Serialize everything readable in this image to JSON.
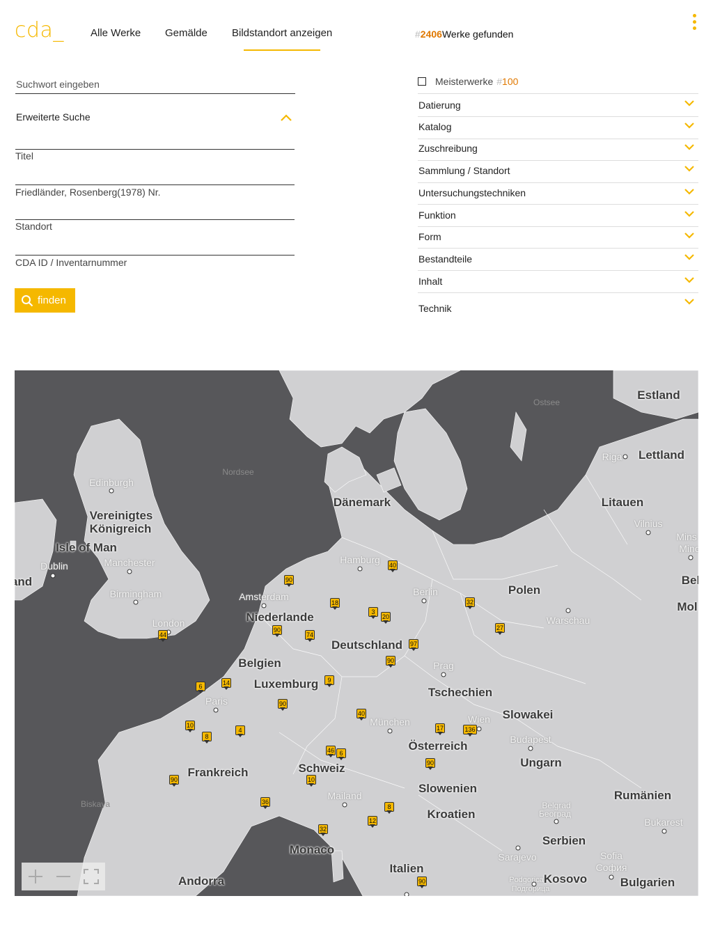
{
  "header": {
    "logo": "cda_",
    "nav": [
      "Alle Werke",
      "Gemälde",
      "Bildstandort anzeigen"
    ],
    "found_hash": "#",
    "found_count": "2406",
    "found_label": "Werke gefunden"
  },
  "search": {
    "placeholder": "Suchwort eingeben",
    "advanced_label": "Erweiterte Suche",
    "fields": [
      "Titel",
      "Friedländer, Rosenberg(1978) Nr.",
      "Standort",
      "CDA ID / Inventarnummer"
    ],
    "find_button": "finden"
  },
  "filters": {
    "masterpieces_label": "Meisterwerke",
    "masterpieces_hash": "#",
    "masterpieces_count": "100",
    "items": [
      "Datierung",
      "Katalog",
      "Zuschreibung",
      "Sammlung / Standort",
      "Untersuchungstechniken",
      "Funktion",
      "Form",
      "Bestandteile",
      "Inhalt",
      "Technik"
    ]
  },
  "map": {
    "countries": [
      "Estland",
      "Lettland",
      "Litauen",
      "Dänemark",
      "Vereinigtes",
      "Königreich",
      "Isle of Man",
      "Polen",
      "Niederlande",
      "Deutschland",
      "Belgien",
      "Luxemburg",
      "Tschechien",
      "Slowakei",
      "Österreich",
      "Ungarn",
      "Frankreich",
      "Schweiz",
      "Slowenien",
      "Kroatien",
      "Rumänien",
      "Serbien",
      "Monaco",
      "Italien",
      "Andorra",
      "Kosovo",
      "Bulgarien",
      "Mol",
      "Bel",
      "and"
    ],
    "cities": [
      "Edinburgh",
      "Riga",
      "Vilnius",
      "Mins",
      "Minс",
      "Dublin",
      "Manchester",
      "Hamburg",
      "Berlin",
      "Amsterdam",
      "Birmingham",
      "London",
      "Warschau",
      "Prag",
      "Paris",
      "Wien",
      "München",
      "Budapest",
      "Mailand",
      "Belgrad",
      "Београд",
      "Bukarest",
      "Sarajevo",
      "Sofia",
      "София",
      "Podgorica",
      "Подгорица"
    ],
    "seas": [
      "Ostsee",
      "Nordsee",
      "Biskaya"
    ],
    "marker_counts": [
      "40",
      "90",
      "18",
      "3",
      "20",
      "32",
      "27",
      "44",
      "90",
      "74",
      "97",
      "90",
      "6",
      "14",
      "9",
      "90",
      "40",
      "10",
      "8",
      "4",
      "17",
      "136",
      "90",
      "46",
      "6",
      "90",
      "10",
      "36",
      "8",
      "12",
      "32",
      "90"
    ],
    "zoom_controls": [
      "zoom-in",
      "zoom-out",
      "fullscreen"
    ]
  }
}
